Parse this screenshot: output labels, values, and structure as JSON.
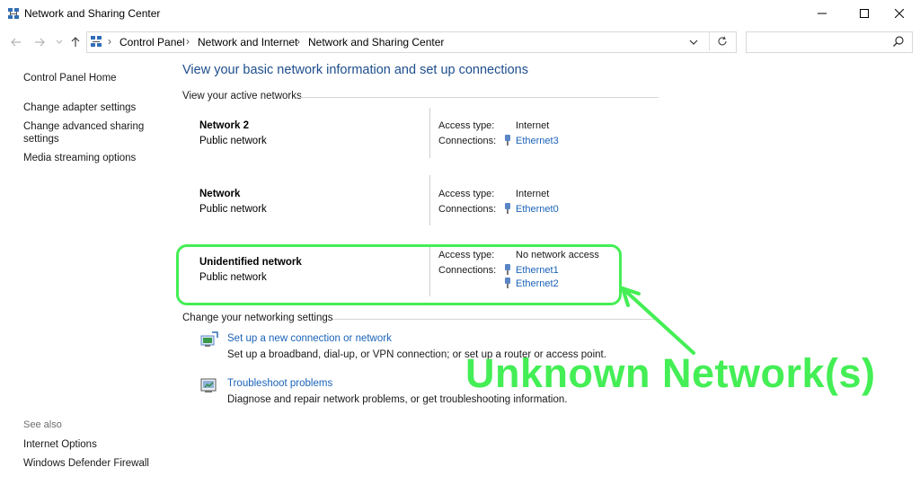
{
  "window": {
    "title": "Network and Sharing Center",
    "controls": {
      "minimize": "minimize",
      "maximize": "maximize",
      "close": "close"
    }
  },
  "address_bar": {
    "breadcrumbs": [
      "Control Panel",
      "Network and Internet",
      "Network and Sharing Center"
    ],
    "search_placeholder": ""
  },
  "sidebar": {
    "items": [
      {
        "label": "Control Panel Home"
      },
      {
        "label": "Change adapter settings"
      },
      {
        "label": "Change advanced sharing"
      },
      {
        "label": "settings"
      },
      {
        "label": "Media streaming options"
      }
    ],
    "see_also_heading": "See also",
    "see_also": [
      {
        "label": "Internet Options"
      },
      {
        "label": "Windows Defender Firewall"
      }
    ]
  },
  "main": {
    "title": "View your basic network information and set up connections",
    "active_networks_heading": "View your active networks",
    "access_type_label": "Access type:",
    "connections_label": "Connections:",
    "networks": [
      {
        "name": "Network 2",
        "type": "Public network",
        "access": "Internet",
        "connections": [
          "Ethernet3"
        ]
      },
      {
        "name": "Network",
        "type": "Public network",
        "access": "Internet",
        "connections": [
          "Ethernet0"
        ]
      },
      {
        "name": "Unidentified network",
        "type": "Public network",
        "access": "No network access",
        "connections": [
          "Ethernet1",
          "Ethernet2"
        ]
      }
    ],
    "settings_heading": "Change your networking settings",
    "tasks": [
      {
        "link": "Set up a new connection or network",
        "desc": "Set up a broadband, dial-up, or VPN connection; or set up a router or access point."
      },
      {
        "link": "Troubleshoot problems",
        "desc": "Diagnose and repair network problems, or get troubleshooting information."
      }
    ]
  },
  "annotation": {
    "text": "Unknown Network(s)",
    "color": "#44ee55"
  },
  "colors": {
    "link": "#1b63b8",
    "title": "#1e4e8c"
  }
}
